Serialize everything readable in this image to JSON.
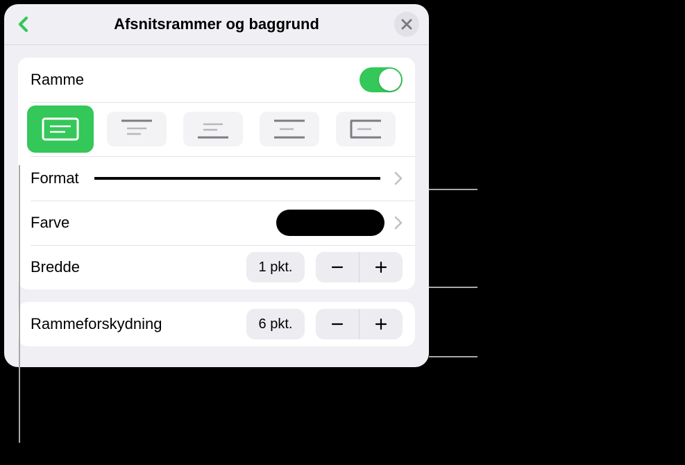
{
  "header": {
    "title": "Afsnitsrammer og baggrund"
  },
  "ramme": {
    "label": "Ramme"
  },
  "format": {
    "label": "Format"
  },
  "farve": {
    "label": "Farve"
  },
  "bredde": {
    "label": "Bredde",
    "value": "1 pkt."
  },
  "offset": {
    "label": "Rammeforskydning",
    "value": "6 pkt."
  }
}
